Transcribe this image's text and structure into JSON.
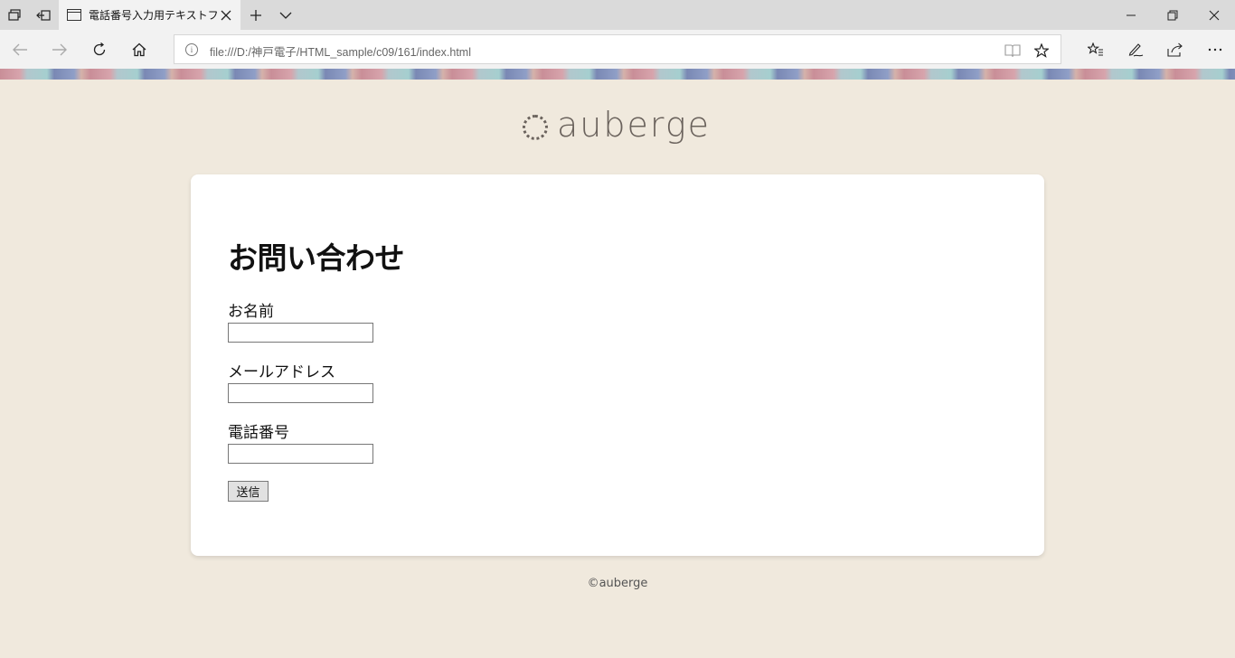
{
  "browser": {
    "tab": {
      "title": "電話番号入力用テキストフ"
    },
    "address": {
      "url": "file:///D:/神戸電子/HTML_sample/c09/161/index.html"
    }
  },
  "page": {
    "logo_text": "auberge",
    "heading": "お問い合わせ",
    "fields": [
      {
        "label": "お名前",
        "value": ""
      },
      {
        "label": "メールアドレス",
        "value": ""
      },
      {
        "label": "電話番号",
        "value": ""
      }
    ],
    "submit_label": "送信",
    "footer": "©auberge"
  },
  "colors": {
    "page_bg": "#f0e9dd",
    "card_bg": "#ffffff",
    "logo": "#6a625c",
    "stripe": [
      "#c98e98",
      "#a5cfcf",
      "#7a88b4"
    ]
  }
}
